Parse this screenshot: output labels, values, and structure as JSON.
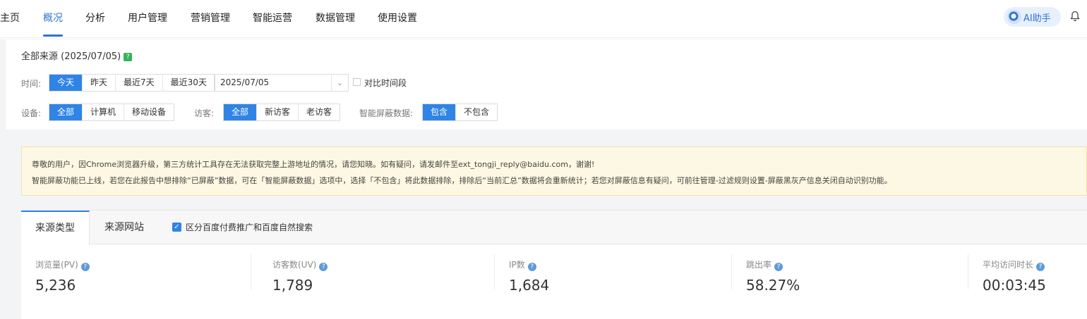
{
  "nav": {
    "items": [
      "主页",
      "概况",
      "分析",
      "用户管理",
      "营销管理",
      "智能运营",
      "数据管理",
      "使用设置"
    ],
    "active_index": 1,
    "ai_label": "AI助手"
  },
  "filter": {
    "source_title": "全部来源 (2025/07/05)",
    "help_mark": "?",
    "time_label": "时间:",
    "time_options": [
      "今天",
      "昨天",
      "最近7天",
      "最近30天"
    ],
    "date_value": "2025/07/05",
    "compare_label": "对比时间段",
    "device_label": "设备:",
    "device_options": [
      "全部",
      "计算机",
      "移动设备"
    ],
    "visitor_label": "访客:",
    "visitor_options": [
      "全部",
      "新访客",
      "老访客"
    ],
    "shield_label": "智能屏蔽数据:",
    "shield_options": [
      "包含",
      "不包含"
    ]
  },
  "notice": {
    "line1": "尊敬的用户，因Chrome浏览器升级，第三方统计工具存在无法获取完整上游地址的情况，请您知晓。如有疑问，请发邮件至ext_tongji_reply@baidu.com，谢谢!",
    "line2": "智能屏蔽功能已上线，若您在此报告中想排除“已屏蔽”数据，可在「智能屏蔽数据」选项中，选择「不包含」将此数据排除，排除后“当前汇总”数据将会重新统计；若您对屏蔽信息有疑问，可前往管理-过滤规则设置-屏蔽黑灰产信息关闭自动识别功能。"
  },
  "stats": {
    "tabs": [
      "来源类型",
      "来源网站"
    ],
    "checkbox_label": "区分百度付费推广和百度自然搜索",
    "checkbox_checked": true,
    "metrics": [
      {
        "label": "浏览量(PV)",
        "value": "5,236"
      },
      {
        "label": "访客数(UV)",
        "value": "1,789"
      },
      {
        "label": "IP数",
        "value": "1,684"
      },
      {
        "label": "跳出率",
        "value": "58.27%"
      },
      {
        "label": "平均访问时长",
        "value": "00:03:45"
      }
    ]
  },
  "colors": {
    "accent": "#2f84e5",
    "nav_active": "#2f74d0",
    "notice_bg": "#fcf8e3",
    "help_green": "#35b35a"
  }
}
